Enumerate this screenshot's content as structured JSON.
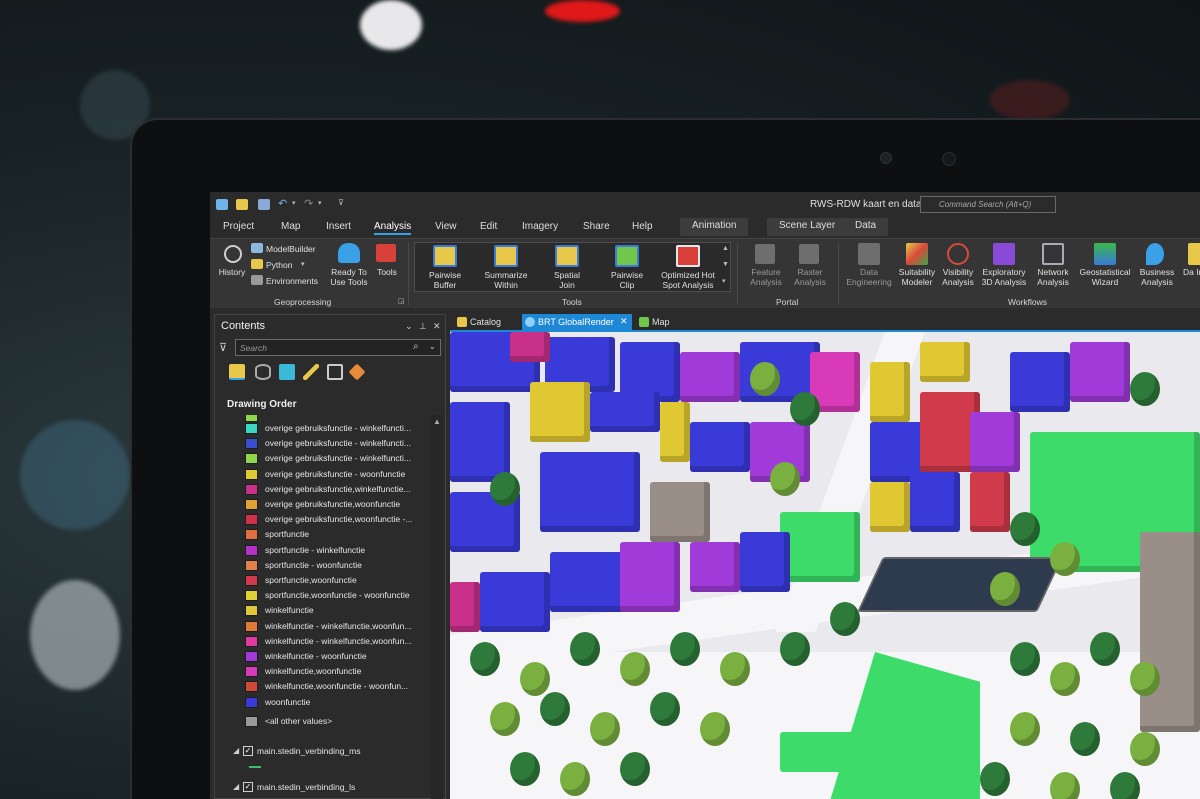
{
  "app": {
    "title": "RWS-RDW kaart en data",
    "command_search_placeholder": "Command Search (Alt+Q)"
  },
  "ribbon_tabs": [
    "Project",
    "Map",
    "Insert",
    "Analysis",
    "View",
    "Edit",
    "Imagery",
    "Share",
    "Help",
    "Animation",
    "Scene Layer",
    "Data"
  ],
  "active_tab": "Analysis",
  "ribbon": {
    "geoprocessing": {
      "group_label": "Geoprocessing",
      "history": "History",
      "modelbuilder": "ModelBuilder",
      "python": "Python",
      "environments": "Environments",
      "ready_to_use": "Ready To Use Tools",
      "tools": "Tools"
    },
    "tools": {
      "group_label": "Tools",
      "pairwise_buffer": "Pairwise Buffer",
      "summarize_within": "Summarize Within",
      "spatial_join": "Spatial Join",
      "pairwise_clip": "Pairwise Clip",
      "optimized_hot_spot": "Optimized Hot Spot Analysis"
    },
    "portal": {
      "group_label": "Portal",
      "feature_analysis": "Feature Analysis",
      "raster_analysis": "Raster Analysis"
    },
    "workflows": {
      "group_label": "Workflows",
      "data_engineering": "Data Engineering",
      "suitability_modeler": "Suitability Modeler",
      "visibility_analysis": "Visibility Analysis",
      "exploratory_3d": "Exploratory 3D Analysis",
      "network_analysis": "Network Analysis",
      "geostatistical_wizard": "Geostatistical Wizard",
      "business_analysis": "Business Analysis",
      "data_interop": "Da Intero"
    }
  },
  "contents": {
    "title": "Contents",
    "search_placeholder": "Search",
    "drawing_order": "Drawing Order",
    "legend": [
      {
        "label": "overige gebruiksfunctie - winkelfuncti...",
        "color": "#3ad6c2"
      },
      {
        "label": "overige gebruiksfunctie - winkelfuncti...",
        "color": "#3a4fd0"
      },
      {
        "label": "overige gebruiksfunctie - winkelfuncti...",
        "color": "#8ed64a"
      },
      {
        "label": "overige gebruiksfunctie - woonfunctie",
        "color": "#e0c832"
      },
      {
        "label": "overige gebruiksfunctie,winkelfunctie...",
        "color": "#c8308a"
      },
      {
        "label": "overige gebruiksfunctie,woonfunctie",
        "color": "#e0a032"
      },
      {
        "label": "overige gebruiksfunctie,woonfunctie -...",
        "color": "#d0304a"
      },
      {
        "label": "sportfunctie",
        "color": "#e07040"
      },
      {
        "label": "sportfunctie - winkelfunctie",
        "color": "#b432c8"
      },
      {
        "label": "sportfunctie - woonfunctie",
        "color": "#e0804a"
      },
      {
        "label": "sportfunctie,woonfunctie",
        "color": "#d03a4a"
      },
      {
        "label": "sportfunctie,woonfunctie - woonfunctie",
        "color": "#e0d032"
      },
      {
        "label": "winkelfunctie",
        "color": "#e0c83a"
      },
      {
        "label": "winkelfunctie - winkelfunctie,woonfun...",
        "color": "#e07a3a"
      },
      {
        "label": "winkelfunctie - winkelfunctie,woonfun...",
        "color": "#e03aa0"
      },
      {
        "label": "winkelfunctie - woonfunctie",
        "color": "#a03ad8"
      },
      {
        "label": "winkelfunctie,woonfunctie",
        "color": "#d83ab8"
      },
      {
        "label": "winkelfunctie,woonfunctie - woonfun...",
        "color": "#d04a3a"
      },
      {
        "label": "woonfunctie",
        "color": "#3a3ad8"
      }
    ],
    "all_other_values": "<all other values>",
    "layers": [
      "main.stedin_verbinding_ms",
      "main.stedin_verbinding_ls"
    ]
  },
  "view_tabs": [
    {
      "label": "Catalog",
      "active": false
    },
    {
      "label": "BRT GlobalRender",
      "active": true
    },
    {
      "label": "Map",
      "active": false
    }
  ],
  "colors": {
    "accent": "#1f88d6",
    "residential": "#3a3ad8",
    "park_green": "#3ddc6a"
  }
}
